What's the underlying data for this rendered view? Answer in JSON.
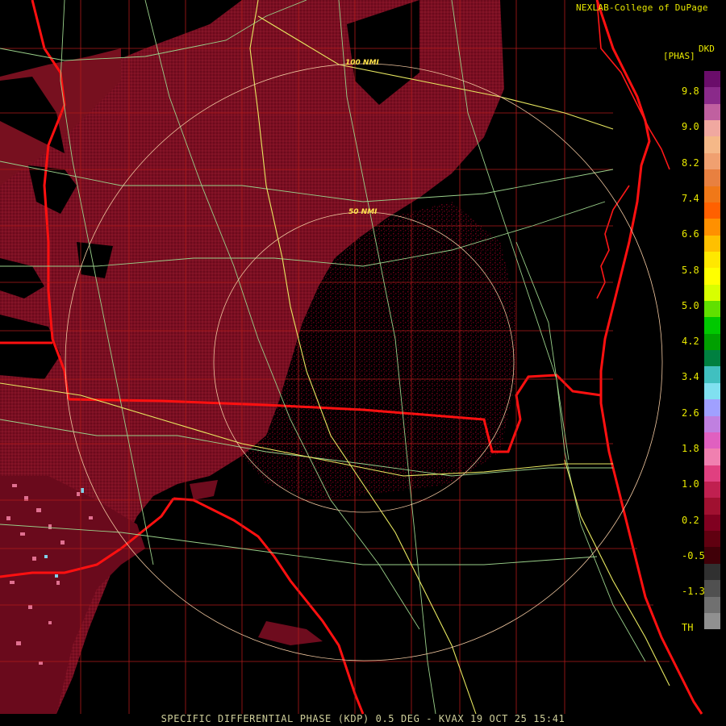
{
  "header": {
    "credit": "NEXLAB-College of DuPage",
    "product_code": "DKD",
    "product_unit": "[PHAS]"
  },
  "range_rings": {
    "inner_label": "50 NMI",
    "outer_label": "100 NMI"
  },
  "legend": {
    "ticks": [
      "9.8",
      "9.0",
      "8.2",
      "7.4",
      "6.6",
      "5.8",
      "5.0",
      "4.2",
      "3.4",
      "2.6",
      "1.8",
      "1.0",
      "0.2",
      "-0.5",
      "-1.3",
      "TH"
    ],
    "colors": [
      "#6a0d6a",
      "#8a2a8a",
      "#c060a0",
      "#f0a8a0",
      "#f5b888",
      "#f0a070",
      "#e88040",
      "#f07818",
      "#ff6000",
      "#ff9000",
      "#ffc000",
      "#ffe800",
      "#ffff00",
      "#d8ff00",
      "#60e000",
      "#00c800",
      "#00a000",
      "#008040",
      "#40c0c0",
      "#80e0f0",
      "#a0a0ff",
      "#c080e0",
      "#e060c0",
      "#f080b0",
      "#e04080",
      "#c02050",
      "#a01030",
      "#800020",
      "#600010",
      "#400008",
      "#303030",
      "#505050",
      "#707070",
      "#909090",
      "#000000"
    ]
  },
  "footer": {
    "caption": "SPECIFIC DIFFERENTIAL PHASE (KDP) 0.5 DEG - KVAX 19 OCT 25 15:41"
  }
}
